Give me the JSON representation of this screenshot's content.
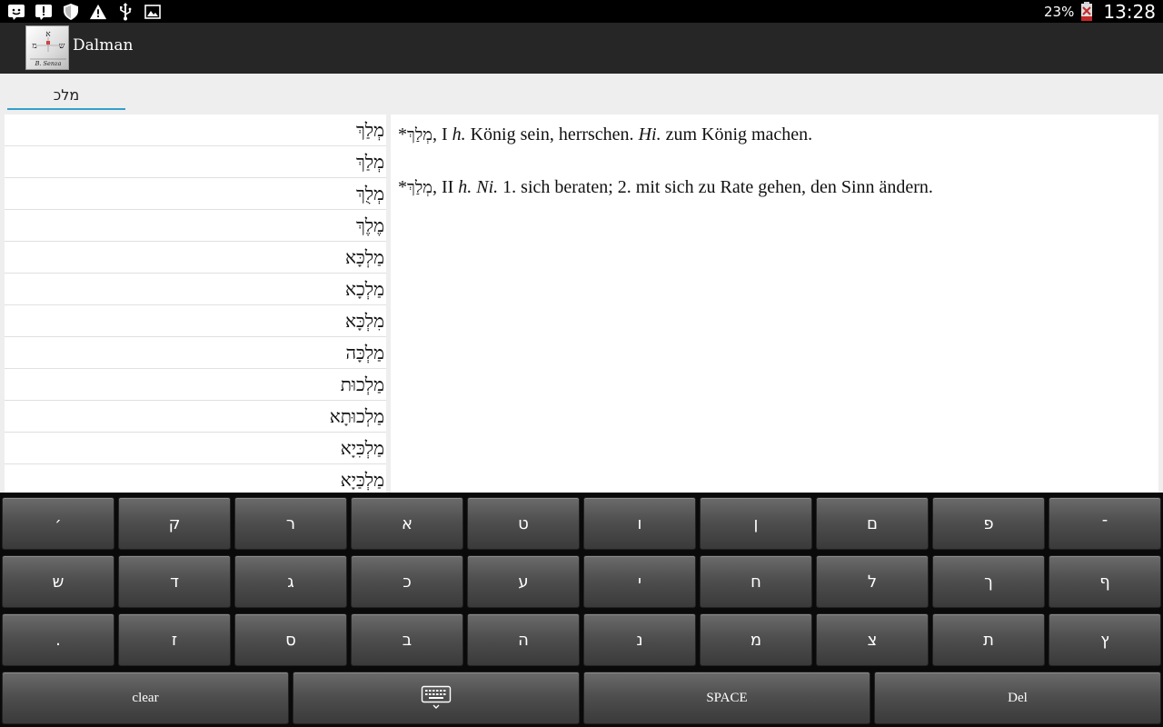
{
  "status_bar": {
    "icons": [
      "notification-face-icon",
      "alert-icon",
      "shield-icon",
      "warning-icon",
      "usb-icon",
      "image-icon"
    ],
    "battery_percent": "23%",
    "time": "13:28"
  },
  "action_bar": {
    "title": "Dalman",
    "logo_icon": "dalman-logo-icon"
  },
  "search": {
    "value": "מלכ"
  },
  "word_list": [
    "מְלַךְ",
    "מְלַךְ",
    "מְלֻךְ",
    "מֶלֶךְ",
    "מַלְכָּא",
    "מַלְכָא",
    "מִלְכָּא",
    "מַלְכָּה",
    "מַלְכוּת",
    "מַלְכוּתָא",
    "מַלְכִּיָא",
    "מַלְכַּיָא"
  ],
  "definitions": [
    {
      "star": "*",
      "headword": "מְלַךְ",
      "numeral": ", I ",
      "abbr1": "h.",
      "text1": " König sein, herrschen. ",
      "abbr2": "Hi.",
      "text2": " zum König machen."
    },
    {
      "star": "*",
      "headword": "מְלַךְ",
      "numeral": ", II ",
      "abbr1": "h. Ni.",
      "text1": " 1. sich beraten; 2. mit sich zu Rate gehen, den Sinn ändern.",
      "abbr2": "",
      "text2": ""
    }
  ],
  "keyboard": {
    "row1": [
      "׳",
      "ק",
      "ר",
      "א",
      "ט",
      "ו",
      "ן",
      "ם",
      "פ",
      "־"
    ],
    "row2": [
      "ש",
      "ד",
      "ג",
      "כ",
      "ע",
      "י",
      "ח",
      "ל",
      "ך",
      "ף"
    ],
    "row3": [
      ".",
      "ז",
      "ס",
      "ב",
      "ה",
      "נ",
      "מ",
      "צ",
      "ת",
      "ץ"
    ],
    "clear_label": "clear",
    "space_label": "SPACE",
    "del_label": "Del",
    "hide_icon": "keyboard-hide-icon"
  }
}
